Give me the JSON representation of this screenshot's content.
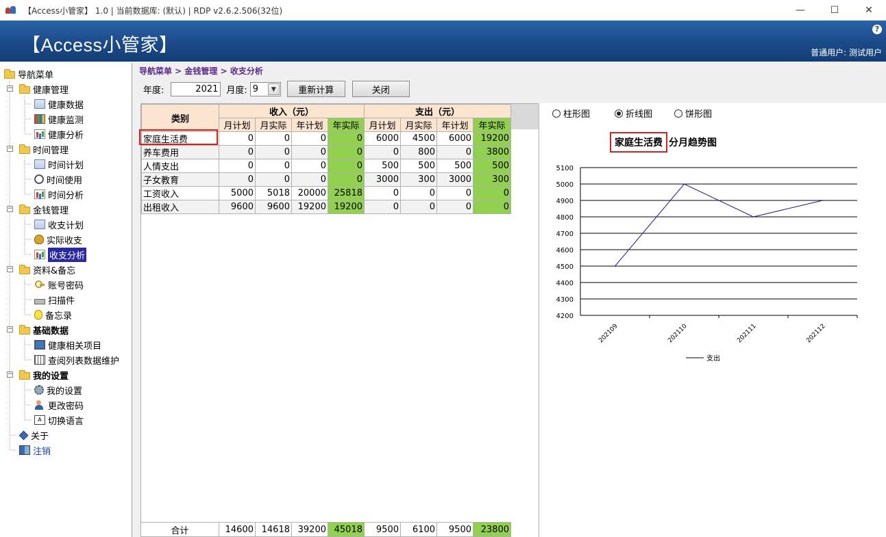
{
  "window": {
    "title": "【Access小管家】 1.0 | 当前数据库: (默认) | RDP v2.6.2.506(32位)",
    "controls": [
      "—",
      "☐",
      "✕"
    ]
  },
  "banner": {
    "brand": "【Access小管家】",
    "help": "?",
    "user": "普通用户: 测试用户"
  },
  "nav": {
    "root": "导航菜单",
    "groups": [
      {
        "label": "健康管理",
        "items": [
          {
            "label": "健康数据",
            "icon": "doc-icon"
          },
          {
            "label": "健康监测",
            "icon": "grid-icon"
          },
          {
            "label": "健康分析",
            "icon": "chart-icon"
          }
        ]
      },
      {
        "label": "时间管理",
        "items": [
          {
            "label": "时间计划",
            "icon": "doc-icon"
          },
          {
            "label": "时间使用",
            "icon": "clock-icon"
          },
          {
            "label": "时间分析",
            "icon": "chart-icon"
          }
        ]
      },
      {
        "label": "金钱管理",
        "items": [
          {
            "label": "收支计划",
            "icon": "doc-icon"
          },
          {
            "label": "实际收支",
            "icon": "money-icon"
          },
          {
            "label": "收支分析",
            "icon": "chart-icon"
          }
        ]
      },
      {
        "label": "资料&备忘",
        "items": [
          {
            "label": "账号密码",
            "icon": "key-icon"
          },
          {
            "label": "扫描件",
            "icon": "scanner-icon"
          },
          {
            "label": "备忘录",
            "icon": "bulb-icon"
          }
        ]
      },
      {
        "label": "基础数据",
        "items": [
          {
            "label": "健康相关项目",
            "icon": "monitor-icon"
          },
          {
            "label": "查阅列表数据维护",
            "icon": "table-icon"
          }
        ]
      },
      {
        "label": "我的设置",
        "items": [
          {
            "label": "我的设置",
            "icon": "gears-icon"
          },
          {
            "label": "更改密码",
            "icon": "user-icon"
          },
          {
            "label": "切换语言",
            "icon": "lang-icon"
          }
        ]
      }
    ],
    "about": "关于",
    "logout": "注销",
    "lang_icon_text": "A"
  },
  "breadcrumb": "导航菜单 > 金钱管理 > 收支分析",
  "toolbar": {
    "year_label": "年度:",
    "year_value": "2021",
    "month_label": "月度:",
    "month_value": "9",
    "recalc_label": "重新计算",
    "close_label": "关闭"
  },
  "grid": {
    "category_header": "类别",
    "income_header": "收入（元）",
    "expense_header": "支出（元）",
    "sub_headers": [
      "月计划",
      "月实际",
      "年计划",
      "年实际",
      "月计划",
      "月实际",
      "年计划",
      "年实际"
    ],
    "rows": [
      {
        "category": "家庭生活费",
        "values": [
          "0",
          "0",
          "0",
          "0",
          "6000",
          "4500",
          "6000",
          "19200"
        ]
      },
      {
        "category": "养车费用",
        "values": [
          "0",
          "0",
          "0",
          "0",
          "0",
          "800",
          "0",
          "3800"
        ]
      },
      {
        "category": "人情支出",
        "values": [
          "0",
          "0",
          "0",
          "0",
          "500",
          "500",
          "500",
          "500"
        ]
      },
      {
        "category": "子女教育",
        "values": [
          "0",
          "0",
          "0",
          "0",
          "3000",
          "300",
          "3000",
          "300"
        ]
      },
      {
        "category": "工资收入",
        "values": [
          "5000",
          "5018",
          "20000",
          "25818",
          "0",
          "0",
          "0",
          "0"
        ]
      },
      {
        "category": "出租收入",
        "values": [
          "9600",
          "9600",
          "19200",
          "19200",
          "0",
          "0",
          "0",
          "0"
        ]
      }
    ],
    "totals_label": "合计",
    "totals": [
      "14600",
      "14618",
      "39200",
      "45018",
      "9500",
      "6100",
      "9500",
      "23800"
    ]
  },
  "chart_options": {
    "bar_label": "柱形图",
    "line_label": "折线图",
    "pie_label": "饼形图",
    "selected": "line"
  },
  "chart_data": {
    "type": "line",
    "title_category": "家庭生活费",
    "title_suffix": "分月趋势图",
    "categories": [
      "202109",
      "202110",
      "202111",
      "202112"
    ],
    "series": [
      {
        "name": "支出",
        "values": [
          4500,
          5000,
          4800,
          4900
        ]
      }
    ],
    "ylim": [
      4200,
      5100
    ],
    "yticks": [
      4200,
      4300,
      4400,
      4500,
      4600,
      4700,
      4800,
      4900,
      5000,
      5100
    ],
    "grid": true,
    "legend_position": "bottom",
    "line_color": "#1a1a8a"
  }
}
